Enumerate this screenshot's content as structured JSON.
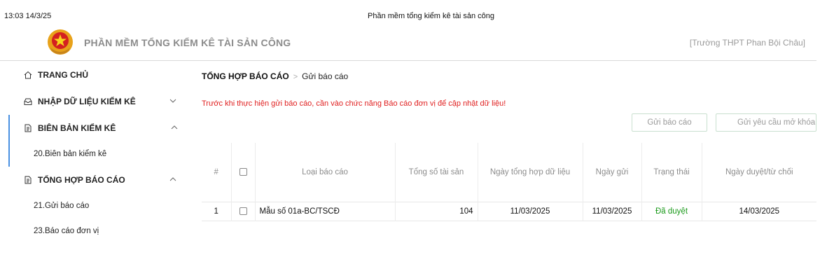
{
  "print": {
    "time": "13:03 14/3/25",
    "title": "Phần mềm tổng kiểm kê tài sản công"
  },
  "header": {
    "app_title": "PHẦN MỀM TỔNG KIỂM KÊ TÀI SẢN CÔNG",
    "unit": "[Trường THPT Phan Bội Châu]"
  },
  "sidebar": {
    "home": "TRANG CHỦ",
    "input": "NHẬP DỮ LIỆU KIỂM KÊ",
    "minutes": "BIÊN BẢN KIỂM KÊ",
    "minutes_sub": "20.Biên bản kiểm kê",
    "summary": "TỔNG HỢP BÁO CÁO",
    "summary_sub1": "21.Gửi báo cáo",
    "summary_sub2": "23.Báo cáo đơn vị"
  },
  "breadcrumb": {
    "parent": "TỔNG HỢP BÁO CÁO",
    "current": "Gửi báo cáo"
  },
  "warning": "Trước khi thực hiện gửi báo cáo, cần vào chức năng Báo cáo đơn vị để cập nhật dữ liệu!",
  "buttons": {
    "send": "Gửi báo cáo",
    "unlock": "Gửi yêu cầu mở khóa"
  },
  "table": {
    "headers": [
      "#",
      "",
      "Loại báo cáo",
      "Tổng số tài sản",
      "Ngày tổng hợp dữ liệu",
      "Ngày gửi",
      "Trạng thái",
      "Ngày duyệt/từ chối"
    ],
    "rows": [
      {
        "index": "1",
        "type": "Mẫu số 01a-BC/TSCĐ",
        "total": "104",
        "summary_date": "11/03/2025",
        "sent_date": "11/03/2025",
        "status": "Đã duyệt",
        "approved_date": "14/03/2025"
      }
    ]
  },
  "colors": {
    "status_ok": "#1b9a1b",
    "warning": "#e02020",
    "accent": "#4a90e2"
  }
}
